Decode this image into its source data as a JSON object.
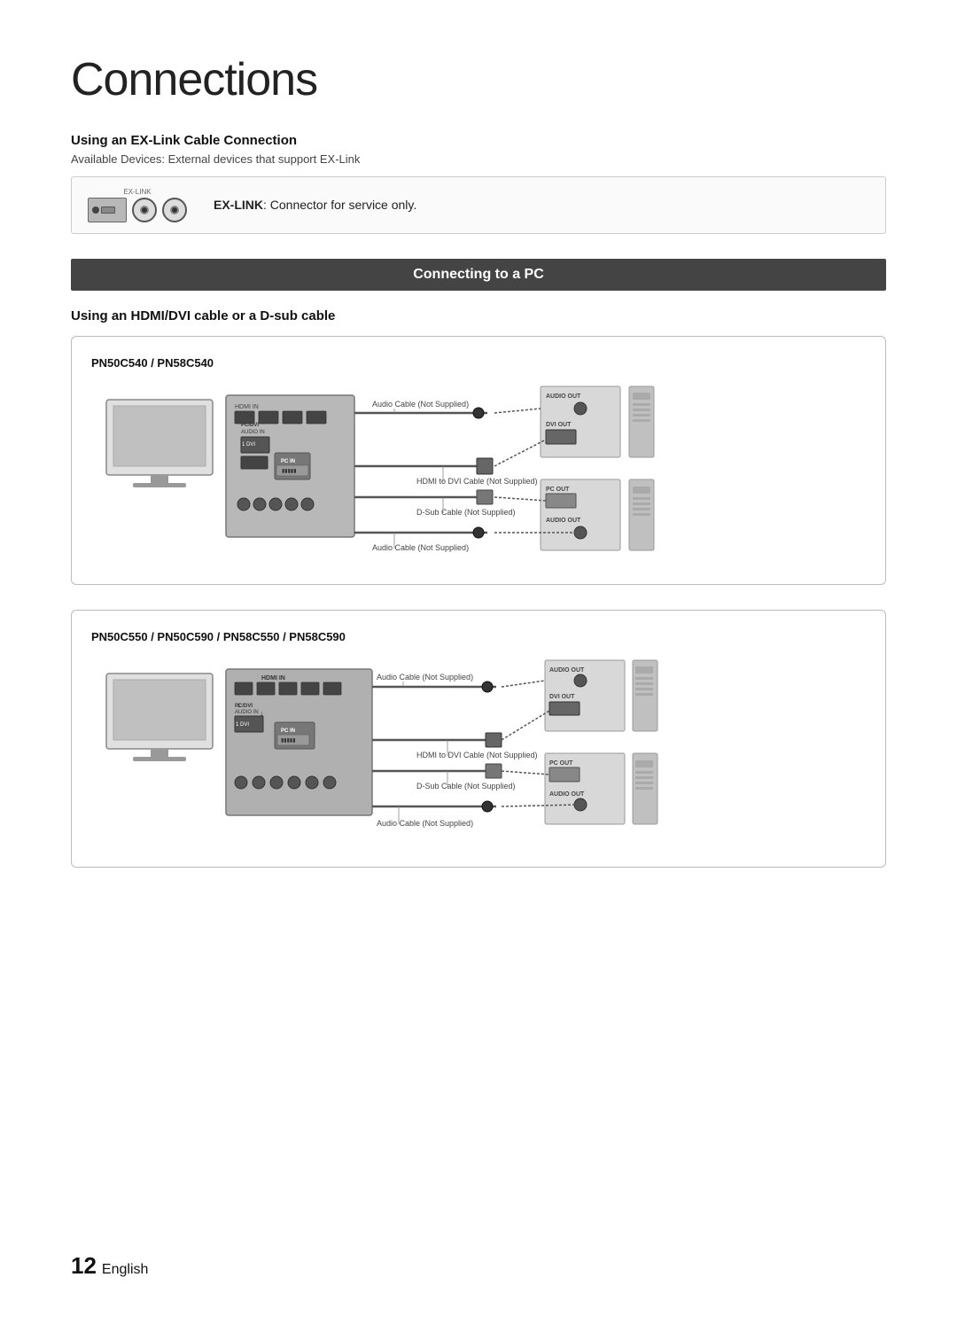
{
  "page": {
    "title": "Connections",
    "page_number": "12",
    "language": "English"
  },
  "exlink_section": {
    "heading": "Using an EX-Link Cable Connection",
    "subtext": "Available Devices: External devices that support EX-Link",
    "label": "EX-LINK",
    "description_bold": "EX-LINK",
    "description": ": Connector for service only."
  },
  "connecting_pc": {
    "bar_label": "Connecting to a PC",
    "subsection_heading": "Using an HDMI/DVI cable or a D-sub cable"
  },
  "diagram1": {
    "model_label": "PN50C540 / PN58C540",
    "cable_labels": [
      "Audio Cable (Not Supplied)",
      "HDMI to DVI Cable (Not Supplied)",
      "D-Sub Cable (Not Supplied)",
      "Audio Cable (Not Supplied)"
    ],
    "pc_labels": [
      "AUDIO OUT",
      "DVI OUT",
      "PC OUT",
      "AUDIO OUT"
    ]
  },
  "diagram2": {
    "model_label": "PN50C550 / PN50C590 / PN58C550 / PN58C590",
    "cable_labels": [
      "Audio Cable (Not Supplied)",
      "HDMI to DVI Cable (Not Supplied)",
      "D-Sub Cable (Not Supplied)",
      "Audio Cable (Not Supplied)"
    ],
    "pc_labels": [
      "AUDIO OUT",
      "DVI OUT",
      "PC OUT",
      "AUDIO OUT"
    ]
  }
}
